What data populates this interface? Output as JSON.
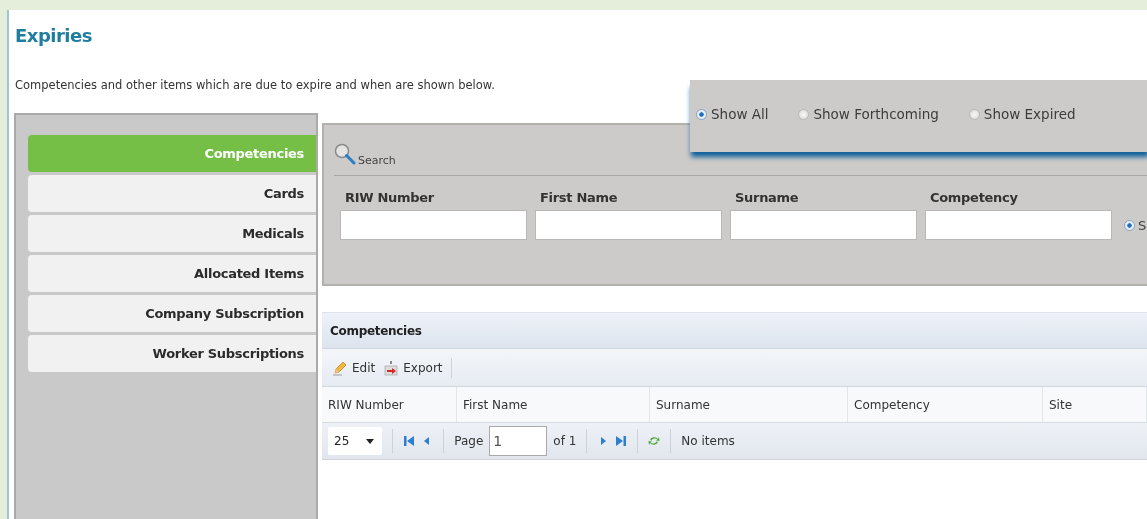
{
  "page": {
    "title": "Expiries",
    "description": "Competencies and other items which are due to expire and when are shown below."
  },
  "sidebar": {
    "items": [
      {
        "label": "Competencies",
        "selected": true
      },
      {
        "label": "Cards",
        "selected": false
      },
      {
        "label": "Medicals",
        "selected": false
      },
      {
        "label": "Allocated Items",
        "selected": false
      },
      {
        "label": "Company Subscription",
        "selected": false
      },
      {
        "label": "Worker Subscriptions",
        "selected": false
      }
    ]
  },
  "search": {
    "heading": "Search",
    "fields": [
      {
        "label": "RIW Number"
      },
      {
        "label": "First Name"
      },
      {
        "label": "Surname"
      },
      {
        "label": "Competency"
      }
    ],
    "filter_radio": {
      "label": "S",
      "selected": true
    }
  },
  "filter_popup": {
    "options": [
      {
        "label": "Show All",
        "selected": true
      },
      {
        "label": "Show Forthcoming",
        "selected": false
      },
      {
        "label": "Show Expired",
        "selected": false
      }
    ]
  },
  "grid": {
    "title": "Competencies",
    "toolbar": [
      {
        "kind": "edit",
        "label": "Edit"
      },
      {
        "kind": "export",
        "label": "Export"
      }
    ],
    "columns": [
      "RIW Number",
      "First Name",
      "Surname",
      "Competency",
      "Site"
    ],
    "pager": {
      "page_size": "25",
      "page_label": "Page",
      "page": "1",
      "of_label": "of 1",
      "status": "No items"
    }
  }
}
